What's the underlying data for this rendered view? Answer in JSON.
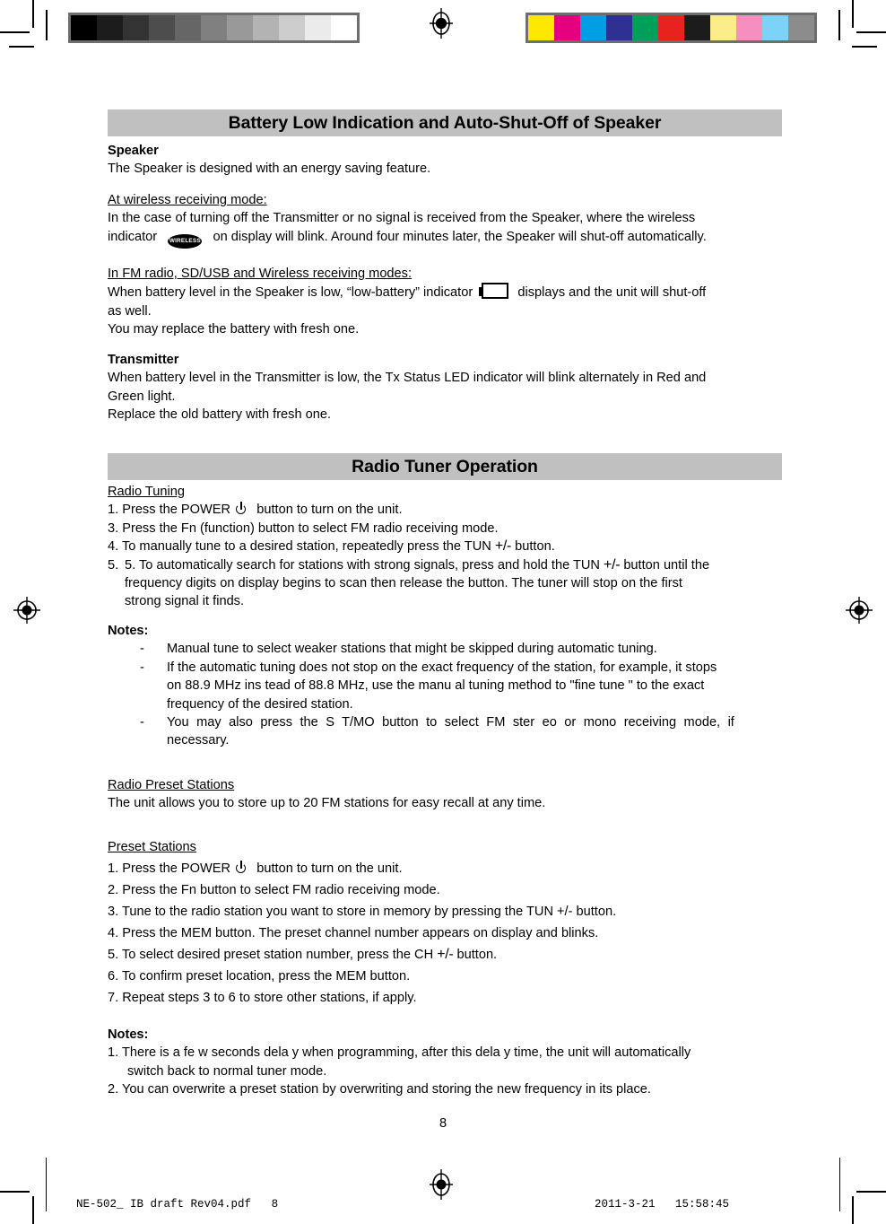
{
  "document": {
    "page_number": "8"
  },
  "prepress": {
    "gray_bar": {
      "name": "grayscale-calibration-bar",
      "swatches": [
        "#000000",
        "#1c1c1c",
        "#333333",
        "#4d4d4d",
        "#666666",
        "#808080",
        "#999999",
        "#b3b3b3",
        "#cccccc",
        "#ebebeb",
        "#ffffff"
      ]
    },
    "color_bar": {
      "name": "color-calibration-bar",
      "swatches": [
        "#ffe800",
        "#e5007e",
        "#009fe3",
        "#2e3192",
        "#00a05a",
        "#e8231f",
        "#1c1c1c",
        "#fbee8a",
        "#f48fc0",
        "#7dd3f7",
        "#8c8c8c"
      ]
    },
    "registration_mark": "registration-target"
  },
  "section1": {
    "header": "Battery Low Indication and Auto-Shut-Off of Speaker",
    "speaker_heading": "Speaker",
    "speaker_line": "The Speaker is designed with an energy saving feature.",
    "wireless_mode_heading": "At wireless receiving mode:",
    "wireless_para_1": "In the case of turning off the Transmitter or no signal is received from the Speaker, where the wireless",
    "wireless_para_2a": "indicator",
    "wireless_icon_label": "WIRELESS",
    "wireless_para_2b": "on display will blink. Around four minutes later, the Speaker will shut-off automatically.",
    "fm_mode_heading": "In FM radio, SD/USB and Wireless receiving modes:",
    "fm_para_1a": "When battery level in the Speaker is low, “low-battery” indicator",
    "fm_para_1b": "displays and the unit will shut-off",
    "fm_para_2": "as well.",
    "fm_para_3": "You may replace the battery with fresh one.",
    "transmitter_heading": "Transmitter",
    "transmitter_para_1": "When battery level in the Transmitter is low, the Tx Status LED indicator will blink alternately in Red and",
    "transmitter_para_2": "Green light.",
    "transmitter_para_3": "Replace the old battery with fresh one."
  },
  "section2": {
    "header": "Radio Tuner Operation",
    "radio_tuning_heading": "Radio Tuning",
    "step1a": "1. Press the POWER",
    "step1b": "button to turn on the unit.",
    "step3": "3. Press the Fn (function) button to select FM radio receiving mode.",
    "step4a": "4. To manually tune to a desired station, repeatedly press the TUN",
    "step4pm": "+/-",
    "step4b": "button.",
    "step5a": "5. To automatically search for stations with strong signals, press and hold the TUN",
    "step5pm": "+/-",
    "step5b": "button until the",
    "step5c": "frequency digits on display begins to scan then release the button. The tuner will stop on the first",
    "step5d": "strong signal it finds.",
    "notes_heading": "Notes:",
    "note_marker": "-",
    "note1": "Manual tune to select weaker stations that might be skipped during automatic tuning.",
    "note2_l1": "If the automatic tuning does not stop on the exact frequency of the station, for example, it stops",
    "note2_l2": "on 88.9 MHz ins tead of 88.8  MHz, use the manu al tuning method  to \"fine tune \" to the exact",
    "note2_l3": "frequency of the desired station.",
    "note3_l1": "You may also press the S T/MO button to select FM ster eo or mono receiving mode, if",
    "note3_l2": "necessary."
  },
  "section3": {
    "preset_stations_heading": "Radio Preset Stations",
    "preset_intro": "The unit allows you to store up to 20 FM stations for easy recall at any time.",
    "preset_sub_heading": "Preset Stations",
    "pstep1a": "1. Press the POWER",
    "pstep1b": "button to turn on the unit.",
    "pstep2": "2. Press the Fn button to select FM radio receiving mode.",
    "pstep3": "3. Tune to the radio station you want to store in memory by pressing the TUN +/- button.",
    "pstep4": "4. Press the MEM button. The preset channel number appears on display and blinks.",
    "pstep5a": "5. To select desired preset station number, press the CH",
    "pstep5pm": "+/-",
    "pstep5b": "button.",
    "pstep6": "6. To confirm preset location, press the MEM button.",
    "pstep7": "7. Repeat steps 3 to 6 to store other stations, if apply.",
    "notes_heading": "Notes:",
    "note1_l1": "1. There is a fe w seconds dela y when programming, after this dela y time, the unit  will automatically",
    "note1_l2": "switch back to normal tuner mode.",
    "note2": "2. You can overwrite a preset station by overwriting and storing the new frequency in its place."
  },
  "footer": {
    "filename": "NE-502_ IB draft Rev04.pdf",
    "file_page": "8",
    "date": "2011-3-21",
    "time": "15:58:45"
  }
}
